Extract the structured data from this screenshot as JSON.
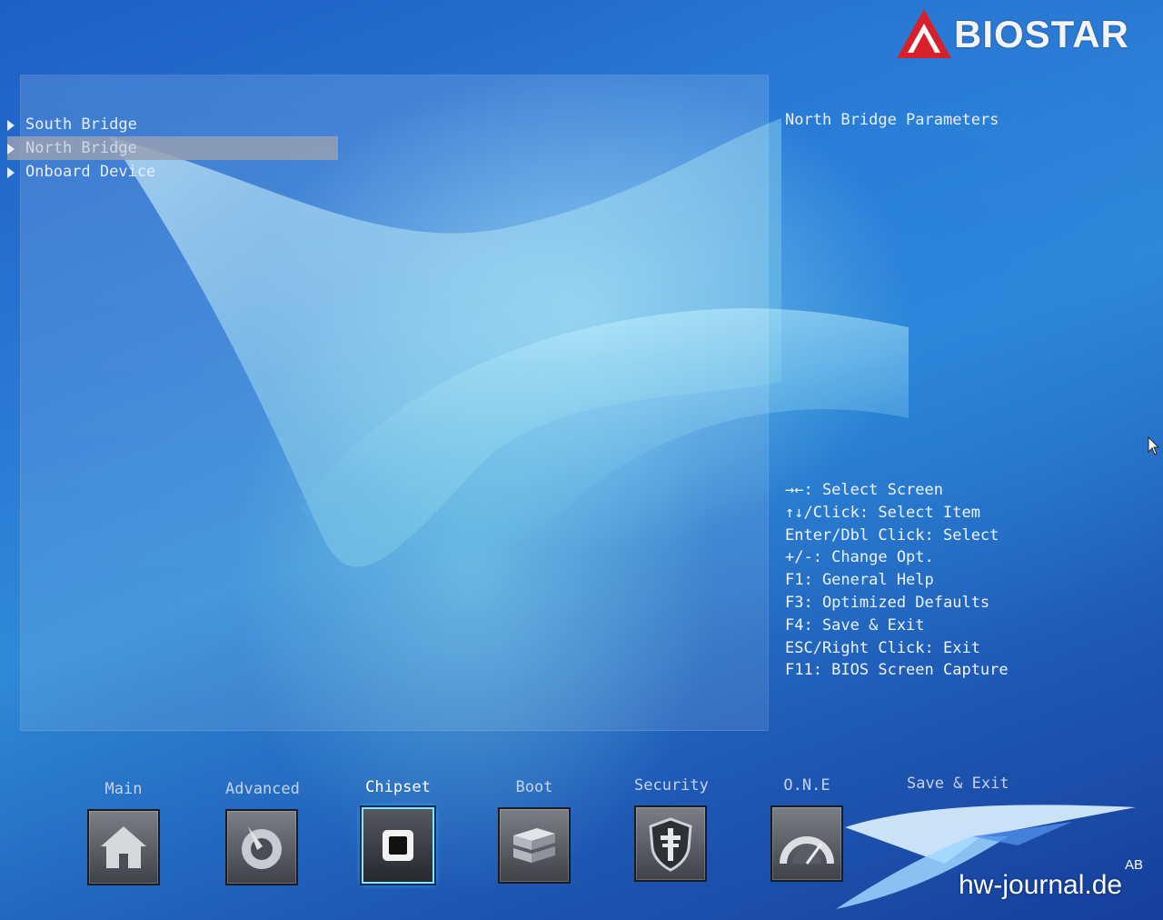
{
  "brand": {
    "name": "BIOSTAR"
  },
  "menu": {
    "items": [
      {
        "label": "South Bridge",
        "selected": false
      },
      {
        "label": "North Bridge",
        "selected": true
      },
      {
        "label": "Onboard Device",
        "selected": false
      }
    ]
  },
  "help": {
    "title": "North Bridge Parameters",
    "keys": [
      "→←: Select Screen",
      "↑↓/Click: Select Item",
      "Enter/Dbl Click: Select",
      "+/-: Change Opt.",
      "F1: General Help",
      "F3: Optimized Defaults",
      "F4: Save & Exit",
      "ESC/Right Click: Exit",
      "F11: BIOS Screen Capture"
    ]
  },
  "tabs": [
    {
      "label": "Main",
      "icon": "home-icon",
      "active": false
    },
    {
      "label": "Advanced",
      "icon": "settings-disc-icon",
      "active": false
    },
    {
      "label": "Chipset",
      "icon": "chip-icon",
      "active": true
    },
    {
      "label": "Boot",
      "icon": "drive-stack-icon",
      "active": false
    },
    {
      "label": "Security",
      "icon": "shield-cross-icon",
      "active": false
    },
    {
      "label": "O.N.E",
      "icon": "speedometer-icon",
      "active": false
    },
    {
      "label": "Save & Exit",
      "icon": "save-exit-icon",
      "active": false
    }
  ],
  "watermark": {
    "text": "hw-journal.de",
    "initials": "AB"
  },
  "colors": {
    "selected_bar": "#969fb3",
    "active_tab_border": "#7fe8ff",
    "background": "#2a78d4"
  }
}
